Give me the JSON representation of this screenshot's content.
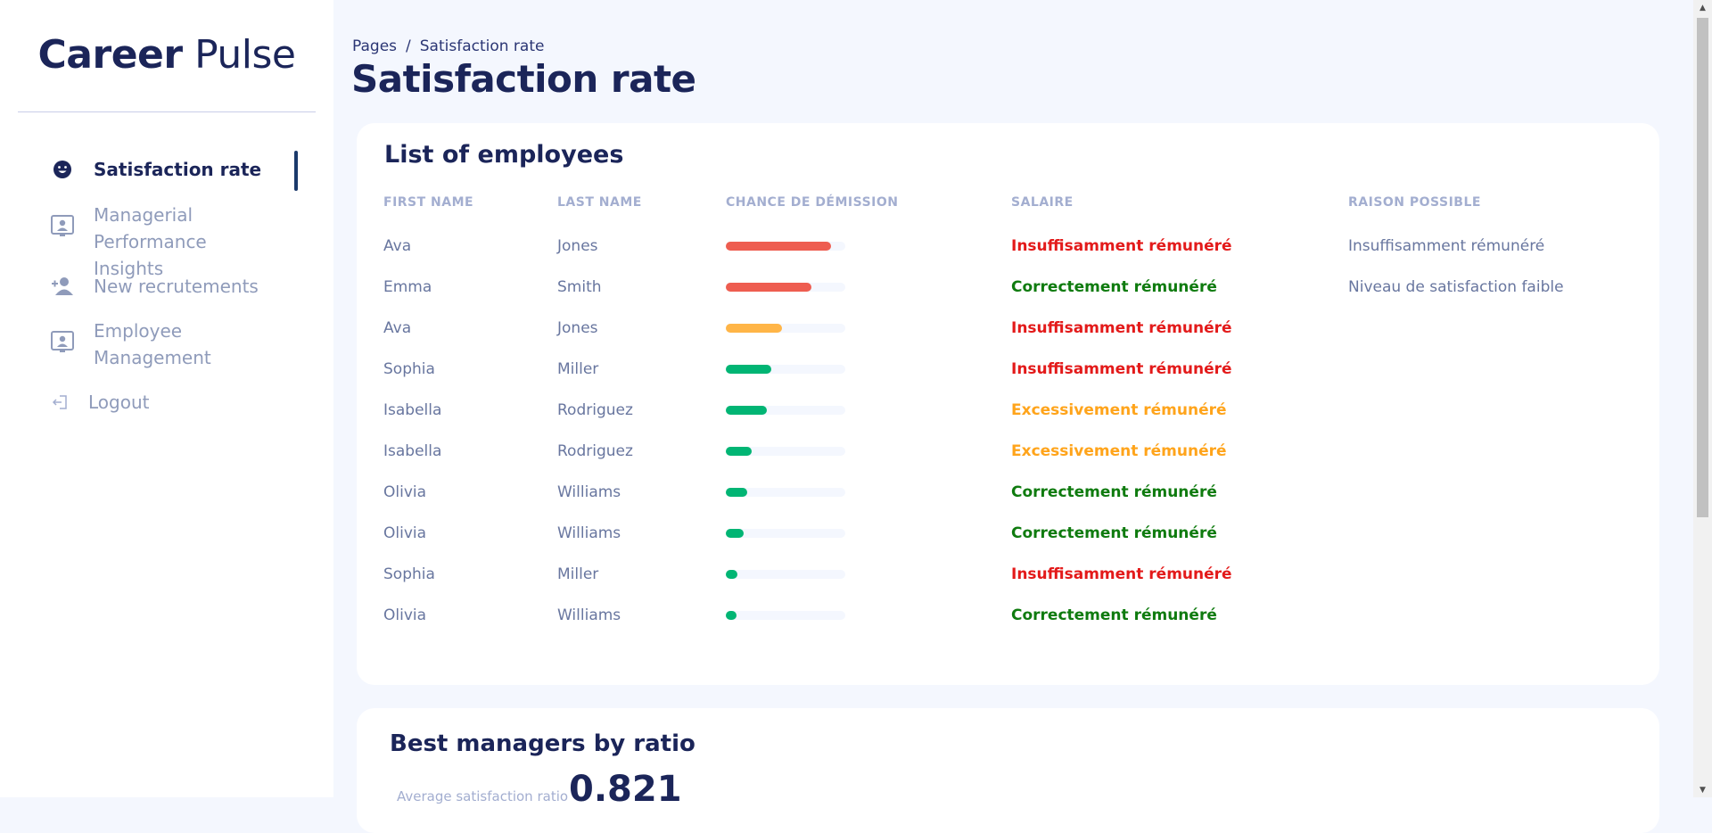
{
  "brand": {
    "bold": "Career",
    "light": "Pulse"
  },
  "sidebar": {
    "items": [
      {
        "label": "Satisfaction rate",
        "icon": "smile-icon"
      },
      {
        "label": "Managerial Performance Insights",
        "icon": "person-board-icon"
      },
      {
        "label": "New recrutements",
        "icon": "add-user-icon"
      },
      {
        "label": "Employee Management",
        "icon": "person-board-icon"
      },
      {
        "label": "Logout",
        "icon": "logout-icon"
      }
    ]
  },
  "breadcrumb": {
    "root": "Pages",
    "separator": "/",
    "current": "Satisfaction rate"
  },
  "page_title": "Satisfaction rate",
  "employees": {
    "title": "List of employees",
    "headers": [
      "FIRST NAME",
      "LAST NAME",
      "CHANCE DE DÉMISSION",
      "SALAIRE",
      "RAISON POSSIBLE"
    ],
    "rows": [
      {
        "first": "Ava",
        "last": "Jones",
        "chance": 0.88,
        "bar_color": "#ee5d50",
        "salary": "Insuffisamment rémunéré",
        "salary_color": "#e31a1a",
        "reason": "Insuffisamment rémunéré"
      },
      {
        "first": "Emma",
        "last": "Smith",
        "chance": 0.72,
        "bar_color": "#ee5d50",
        "salary": "Correctement rémunéré",
        "salary_color": "#0f7b0f",
        "reason": "Niveau de satisfaction faible"
      },
      {
        "first": "Ava",
        "last": "Jones",
        "chance": 0.47,
        "bar_color": "#ffb547",
        "salary": "Insuffisamment rémunéré",
        "salary_color": "#e31a1a",
        "reason": ""
      },
      {
        "first": "Sophia",
        "last": "Miller",
        "chance": 0.38,
        "bar_color": "#01b574",
        "salary": "Insuffisamment rémunéré",
        "salary_color": "#e31a1a",
        "reason": ""
      },
      {
        "first": "Isabella",
        "last": "Rodriguez",
        "chance": 0.34,
        "bar_color": "#01b574",
        "salary": "Excessivement rémunéré",
        "salary_color": "#ffa41b",
        "reason": ""
      },
      {
        "first": "Isabella",
        "last": "Rodriguez",
        "chance": 0.22,
        "bar_color": "#01b574",
        "salary": "Excessivement rémunéré",
        "salary_color": "#ffa41b",
        "reason": ""
      },
      {
        "first": "Olivia",
        "last": "Williams",
        "chance": 0.18,
        "bar_color": "#01b574",
        "salary": "Correctement rémunéré",
        "salary_color": "#0f7b0f",
        "reason": ""
      },
      {
        "first": "Olivia",
        "last": "Williams",
        "chance": 0.15,
        "bar_color": "#01b574",
        "salary": "Correctement rémunéré",
        "salary_color": "#0f7b0f",
        "reason": ""
      },
      {
        "first": "Sophia",
        "last": "Miller",
        "chance": 0.1,
        "bar_color": "#01b574",
        "salary": "Insuffisamment rémunéré",
        "salary_color": "#e31a1a",
        "reason": ""
      },
      {
        "first": "Olivia",
        "last": "Williams",
        "chance": 0.09,
        "bar_color": "#01b574",
        "salary": "Correctement rémunéré",
        "salary_color": "#0f7b0f",
        "reason": ""
      }
    ]
  },
  "managers": {
    "title": "Best managers by ratio",
    "avg_label": "Average satisfaction ratio",
    "avg_value": "0.821"
  }
}
